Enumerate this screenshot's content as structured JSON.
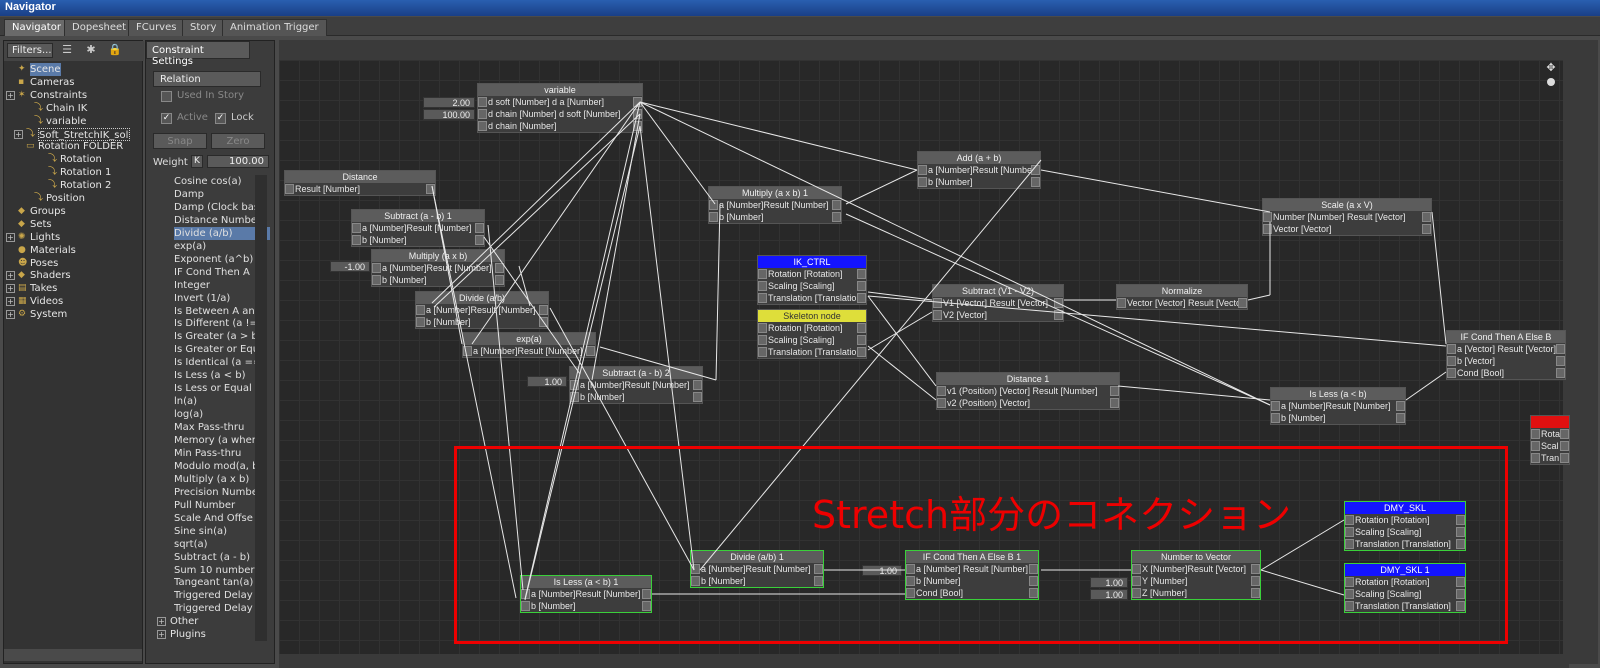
{
  "window": {
    "title": "Navigator"
  },
  "tabs": [
    "Navigator",
    "Dopesheet",
    "FCurves",
    "Story",
    "Animation Trigger"
  ],
  "left": {
    "filters_label": "Filters...",
    "tree": [
      {
        "label": "Scene",
        "sel": true
      },
      {
        "label": "Cameras"
      },
      {
        "label": "Constraints"
      },
      {
        "label": "Chain IK"
      },
      {
        "label": "variable"
      },
      {
        "label": "Soft_StretchIK_solve"
      },
      {
        "label": "Rotation FOLDER"
      },
      {
        "label": "Rotation"
      },
      {
        "label": "Rotation 1"
      },
      {
        "label": "Rotation 2"
      },
      {
        "label": "Position"
      },
      {
        "label": "Groups"
      },
      {
        "label": "Sets"
      },
      {
        "label": "Lights"
      },
      {
        "label": "Materials"
      },
      {
        "label": "Poses"
      },
      {
        "label": "Shaders"
      },
      {
        "label": "Takes"
      },
      {
        "label": "Videos"
      },
      {
        "label": "System"
      }
    ]
  },
  "settings": {
    "tab": "Constraint Settings",
    "relation": "Relation",
    "used_in_story": "Used In Story",
    "active": "Active",
    "lock": "Lock",
    "snap": "Snap",
    "zero": "Zero",
    "weight_label": "Weight",
    "weight_key": "K",
    "weight_value": "100.00",
    "operators": [
      "Cosine cos(a)",
      "Damp",
      "Damp (Clock bas",
      "Distance Number",
      "Divide (a/b)",
      "exp(a)",
      "Exponent (a^b)",
      "IF Cond Then A",
      "Integer",
      "Invert (1/a)",
      "Is Between A an",
      "Is Different (a !=",
      "Is Greater (a > b",
      "Is Greater or Equ",
      "Is Identical (a ==",
      "Is Less (a < b)",
      "Is Less or Equal",
      "ln(a)",
      "log(a)",
      "Max Pass-thru",
      "Memory (a when",
      "Min Pass-thru",
      "Modulo mod(a, b)",
      "Multiply (a x b)",
      "Precision Numbe",
      "Pull Number",
      "Scale And Offse",
      "Sine sin(a)",
      "sqrt(a)",
      "Subtract (a - b)",
      "Sum 10 numbers",
      "Tangeant tan(a)",
      "Triggered Delay",
      "Triggered Delay"
    ],
    "selected_op": "Divide (a/b)",
    "other": "Other",
    "plugins": "Plugins"
  },
  "graph": {
    "annotation": "Stretch部分のコネクション",
    "consts": {
      "soft": "2.00",
      "chain": "100.00",
      "mult": "-1.00",
      "sub2": "1.00",
      "ifc": "1.00",
      "y": "1.00",
      "z": "1.00"
    },
    "nodes": {
      "variable": {
        "title": "variable",
        "rows": [
          "d soft [Number]   d a [Number]",
          "d chain [Number] d soft [Number]",
          "                        d chain [Number]"
        ]
      },
      "distance": {
        "title": "Distance",
        "rows": [
          "                  Result [Number]"
        ]
      },
      "subtract1": {
        "title": "Subtract (a - b) 1",
        "rows": [
          "a [Number]Result [Number]",
          "b [Number]"
        ]
      },
      "multiply": {
        "title": "Multiply (a x b)",
        "rows": [
          "a [Number]Result [Number]",
          "b [Number]"
        ]
      },
      "divide": {
        "title": "Divide (a/b)",
        "rows": [
          "a [Number]Result [Number]",
          "b [Number]"
        ]
      },
      "exp": {
        "title": "exp(a)",
        "rows": [
          "a [Number]Result [Number]"
        ]
      },
      "subtract2": {
        "title": "Subtract (a - b) 2",
        "rows": [
          "a [Number]Result [Number]",
          "b [Number]"
        ]
      },
      "multiply1": {
        "title": "Multiply (a x b) 1",
        "rows": [
          "a [Number]Result [Number]",
          "b [Number]"
        ]
      },
      "add": {
        "title": "Add (a + b)",
        "rows": [
          "a [Number]Result [Number]",
          "b [Number]"
        ]
      },
      "ikctrl": {
        "title": "IK_CTRL",
        "rows": [
          "Rotation [Rotation]",
          "Scaling [Scaling]",
          "Translation [Translation]"
        ]
      },
      "skeleton": {
        "title": "Skeleton node",
        "rows": [
          "Rotation [Rotation]",
          "Scaling [Scaling]",
          "Translation [Translation]"
        ]
      },
      "subtractv": {
        "title": "Subtract (V1 - V2)",
        "rows": [
          "V1 [Vector] Result [Vector]",
          "V2 [Vector]"
        ]
      },
      "normalize": {
        "title": "Normalize",
        "rows": [
          "Vector [Vector]  Result [Vector]"
        ]
      },
      "scale": {
        "title": "Scale (a x V)",
        "rows": [
          "Number [Number] Result [Vector]",
          "Vector [Vector]"
        ]
      },
      "ifcond": {
        "title": "IF Cond Then A Else B",
        "rows": [
          "a [Vector]    Result [Vector]",
          "b [Vector]",
          "Cond [Bool]"
        ]
      },
      "distance1": {
        "title": "Distance 1",
        "rows": [
          "v1 (Position) [Vector]  Result [Number]",
          "v2 (Position) [Vector]"
        ]
      },
      "isless": {
        "title": "Is Less (a < b)",
        "rows": [
          "a [Number]Result [Number]",
          "b [Number]"
        ]
      },
      "isless1": {
        "title": "Is Less (a < b) 1",
        "rows": [
          "a [Number]Result [Number]",
          "b [Number]"
        ]
      },
      "divide1": {
        "title": "Divide (a/b) 1",
        "rows": [
          "a [Number]Result [Number]",
          "b [Number]"
        ]
      },
      "ifcond1": {
        "title": "IF Cond Then A Else B 1",
        "rows": [
          "a [Number] Result [Number]",
          "b [Number]",
          "Cond [Bool]"
        ]
      },
      "numtovec": {
        "title": "Number to Vector",
        "rows": [
          "X [Number]Result [Vector]",
          "Y [Number]",
          "Z [Number]"
        ]
      },
      "dmy": {
        "title": "DMY_SKL",
        "rows": [
          "Rotation [Rotation]",
          "Scaling [Scaling]",
          "Translation [Translation]"
        ]
      },
      "dmy1": {
        "title": "DMY_SKL 1",
        "rows": [
          "Rotation [Rotation]",
          "Scaling [Scaling]",
          "Translation [Translation]"
        ]
      },
      "partial": {
        "title": "",
        "rows": [
          "Rota",
          "Scal",
          "Tran"
        ]
      }
    }
  },
  "colors": {
    "highlight_box": "#ee0000",
    "ik_ctrl_header": "#1414ff",
    "skeleton_header": "#dede3a",
    "selected_node_border": "#3ad03a"
  }
}
